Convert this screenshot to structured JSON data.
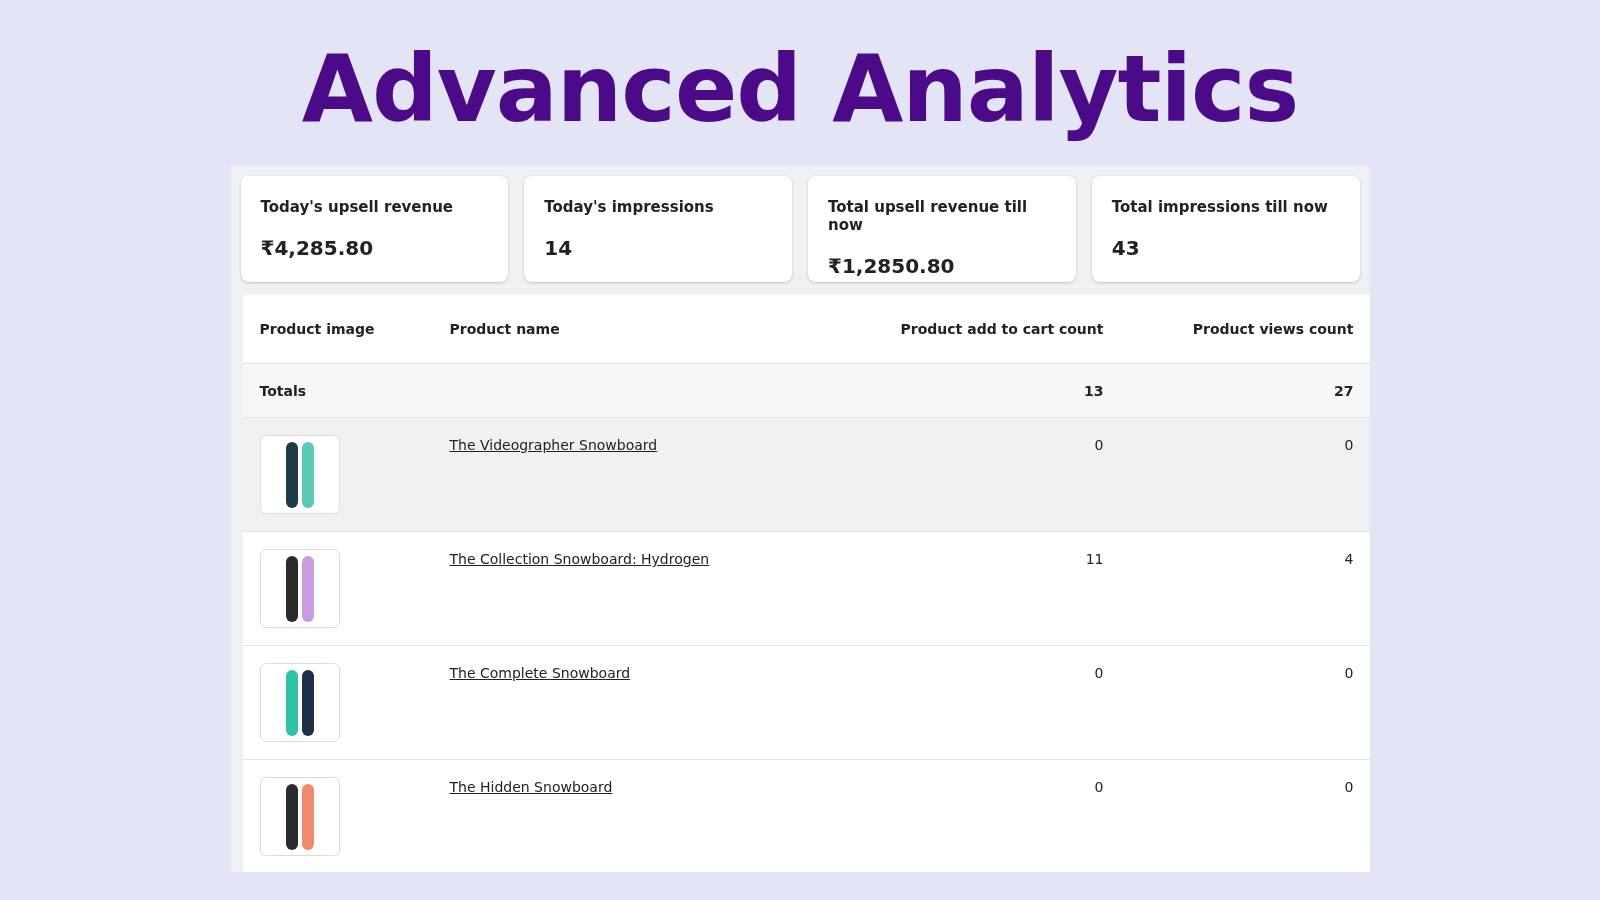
{
  "title": "Advanced Analytics",
  "stats": [
    {
      "label": "Today's upsell revenue",
      "value": "₹4,285.80"
    },
    {
      "label": "Today's impressions",
      "value": "14"
    },
    {
      "label": "Total upsell revenue till now",
      "value": "₹1,2850.80"
    },
    {
      "label": "Total impressions till now",
      "value": "43"
    }
  ],
  "table": {
    "columns": [
      "Product image",
      "Product name",
      "Product add to cart count",
      "Product views count"
    ],
    "totals": {
      "label": "Totals",
      "add_to_cart": "13",
      "views": "27"
    },
    "rows": [
      {
        "name": "The Videographer Snowboard",
        "add_to_cart": "0",
        "views": "0",
        "highlighted": true
      },
      {
        "name": "The Collection Snowboard: Hydrogen",
        "add_to_cart": "11",
        "views": "4",
        "highlighted": false
      },
      {
        "name": "The Complete Snowboard",
        "add_to_cart": "0",
        "views": "0",
        "highlighted": false
      },
      {
        "name": "The Hidden Snowboard",
        "add_to_cart": "0",
        "views": "0",
        "highlighted": false
      }
    ]
  }
}
